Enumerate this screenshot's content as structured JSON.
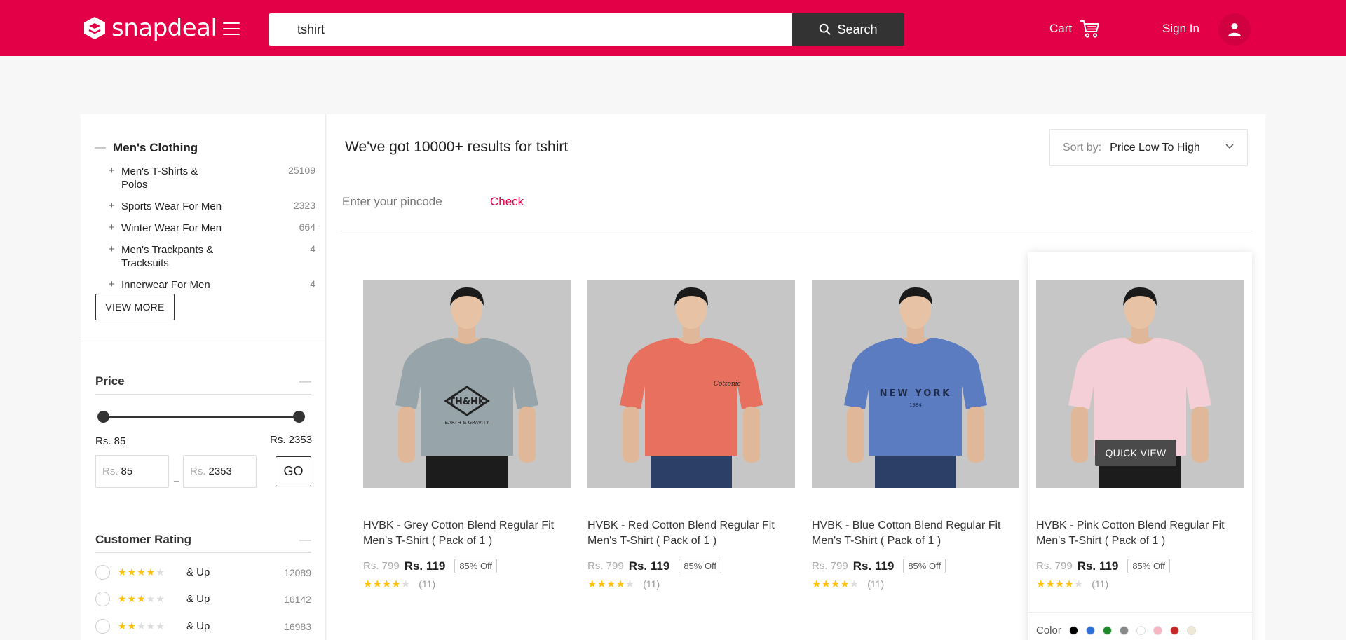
{
  "header": {
    "logo_text": "snapdeal",
    "search_value": "tshirt",
    "search_button": "Search",
    "cart_label": "Cart",
    "signin_label": "Sign In",
    "brand_color": "#e40046"
  },
  "sidebar": {
    "category_title": "Men's Clothing",
    "categories": [
      {
        "label": "Men's T-Shirts & Polos",
        "count": "25109"
      },
      {
        "label": "Sports Wear For Men",
        "count": "2323"
      },
      {
        "label": "Winter Wear For Men",
        "count": "664"
      },
      {
        "label": "Men's Trackpants & Tracksuits",
        "count": "4"
      },
      {
        "label": "Innerwear For Men",
        "count": "4"
      }
    ],
    "view_more": "VIEW MORE",
    "price": {
      "title": "Price",
      "min_label": "Rs. 85",
      "max_label": "Rs. 2353",
      "currency": "Rs.",
      "min_value": "85",
      "max_value": "2353",
      "go": "GO"
    },
    "rating": {
      "title": "Customer Rating",
      "options": [
        {
          "stars": 4,
          "label": "& Up",
          "count": "12089"
        },
        {
          "stars": 3,
          "label": "& Up",
          "count": "16142"
        },
        {
          "stars": 2,
          "label": "& Up",
          "count": "16983"
        }
      ]
    }
  },
  "main": {
    "results_text": "We've got 10000+ results for tshirt",
    "sort_label": "Sort by:",
    "sort_value": "Price Low To High",
    "pincode_placeholder": "Enter your pincode",
    "check": "Check",
    "quick_view": "QUICK VIEW",
    "color_label": "Color",
    "products": [
      {
        "title": "HVBK - Grey Cotton Blend Regular Fit Men's T-Shirt ( Pack of 1 )",
        "old_price": "Rs. 799",
        "price": "Rs. 119",
        "discount": "85% Off",
        "rating_count": "(11)",
        "shirt_color": "#97a4aa",
        "print": "grey"
      },
      {
        "title": "HVBK - Red Cotton Blend Regular Fit Men's T-Shirt ( Pack of 1 )",
        "old_price": "Rs. 799",
        "price": "Rs. 119",
        "discount": "85% Off",
        "rating_count": "(11)",
        "shirt_color": "#e8705f",
        "print": "red"
      },
      {
        "title": "HVBK - Blue Cotton Blend Regular Fit Men's T-Shirt ( Pack of 1 )",
        "old_price": "Rs. 799",
        "price": "Rs. 119",
        "discount": "85% Off",
        "rating_count": "(11)",
        "shirt_color": "#5b7cc0",
        "print": "blue"
      },
      {
        "title": "HVBK - Pink Cotton Blend Regular Fit Men's T-Shirt ( Pack of 1 )",
        "old_price": "Rs. 799",
        "price": "Rs. 119",
        "discount": "85% Off",
        "rating_count": "(11)",
        "shirt_color": "#f5cfd8",
        "print": "pink"
      }
    ],
    "color_swatches": [
      "#000000",
      "#2f6fd6",
      "#1f8c2c",
      "#888888",
      "#ffffff",
      "#f6b6c4",
      "#c62828",
      "#efe8d6"
    ]
  }
}
